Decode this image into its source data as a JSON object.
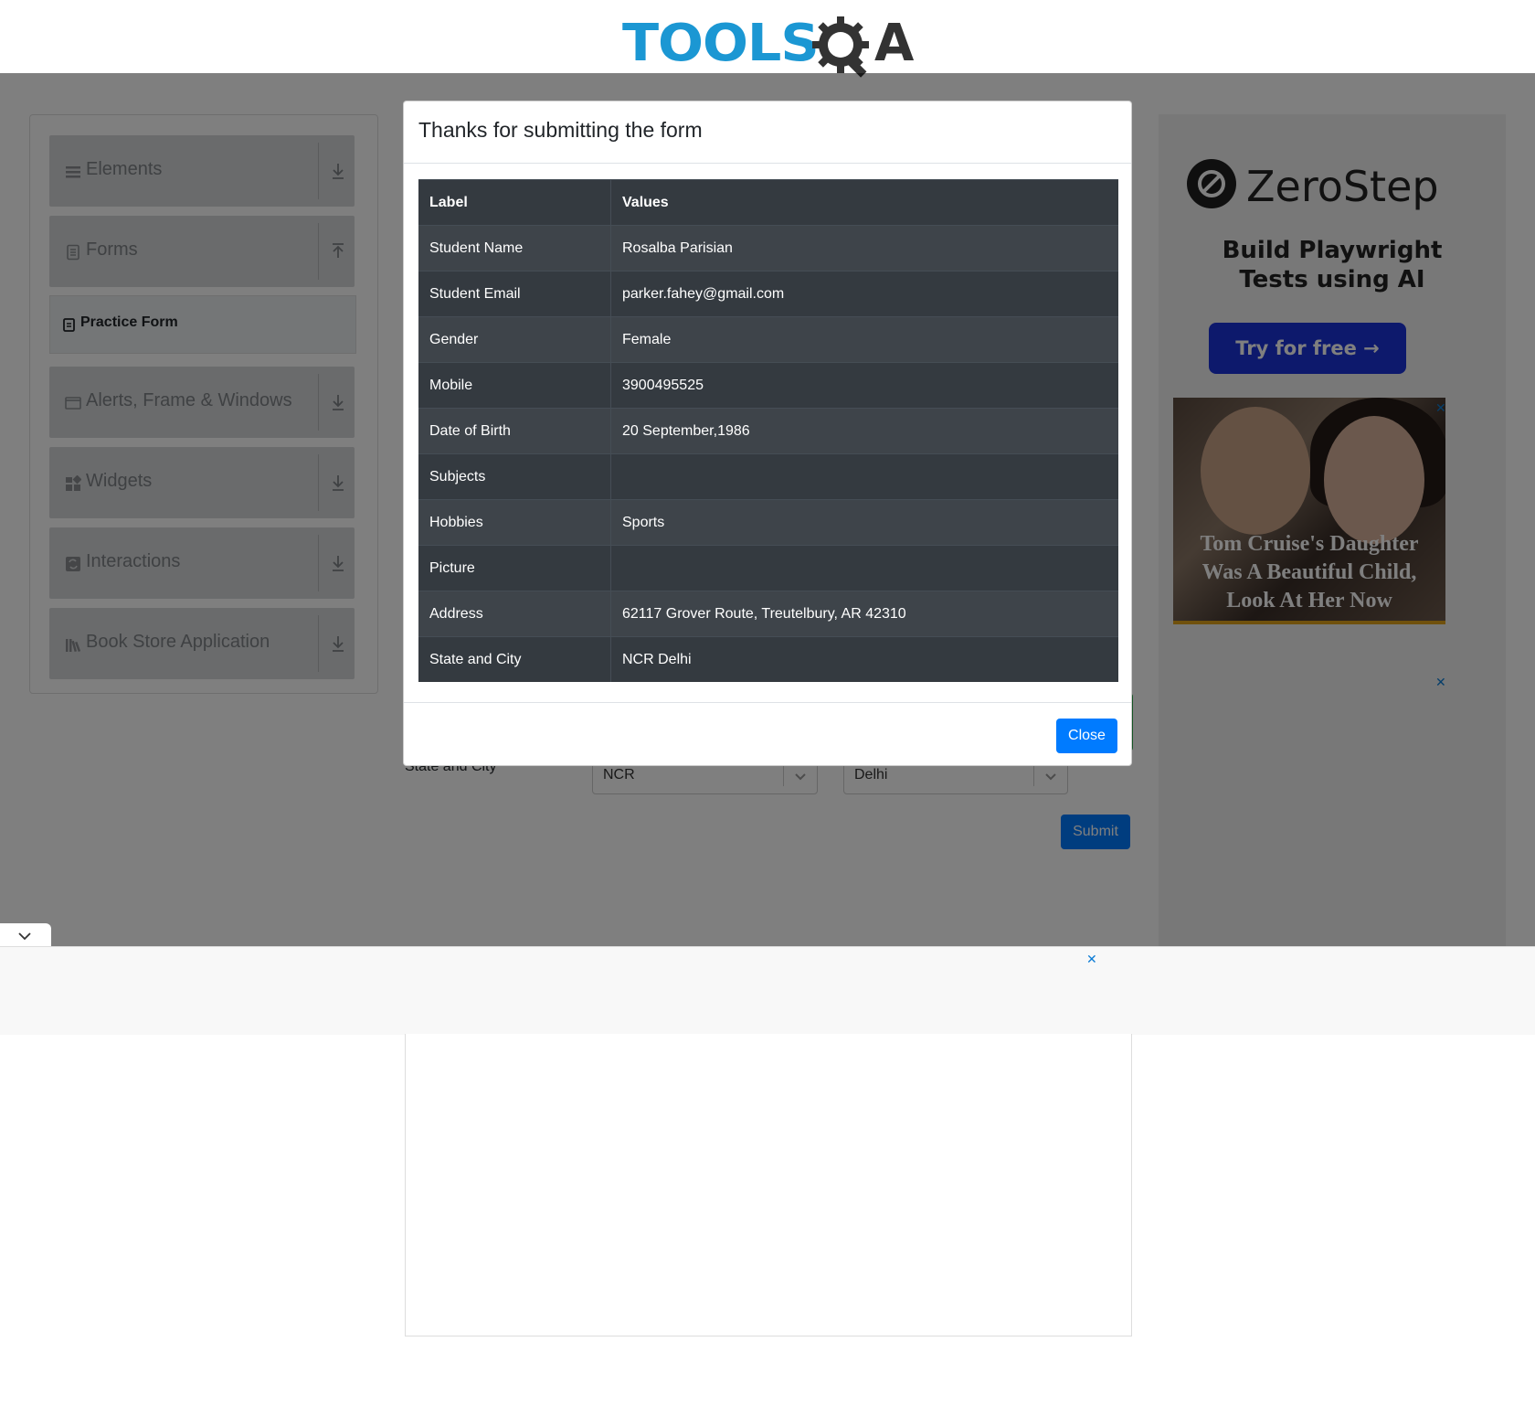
{
  "header": {
    "logo_text": "TOOLS",
    "logo_text_end": "A"
  },
  "sidebar": {
    "groups": [
      {
        "label": "Elements",
        "icon": "list-icon",
        "arrow": "download-arrow-icon"
      },
      {
        "label": "Forms",
        "icon": "document-icon",
        "arrow": "upload-arrow-icon"
      },
      {
        "label": "Alerts, Frame & Windows",
        "icon": "window-icon",
        "arrow": "download-arrow-icon"
      },
      {
        "label": "Widgets",
        "icon": "widgets-icon",
        "arrow": "download-arrow-icon"
      },
      {
        "label": "Interactions",
        "icon": "interactions-icon",
        "arrow": "download-arrow-icon"
      },
      {
        "label": "Book Store Application",
        "icon": "books-icon",
        "arrow": "download-arrow-icon"
      }
    ],
    "active_item": "Practice Form"
  },
  "form": {
    "state_city_label": "State and City",
    "state_value": "NCR",
    "city_value": "Delhi",
    "submit_label": "Submit"
  },
  "modal": {
    "title": "Thanks for submitting the form",
    "header_label": "Label",
    "header_values": "Values",
    "rows": [
      {
        "label": "Student Name",
        "value": "Rosalba Parisian"
      },
      {
        "label": "Student Email",
        "value": "parker.fahey@gmail.com"
      },
      {
        "label": "Gender",
        "value": "Female"
      },
      {
        "label": "Mobile",
        "value": "3900495525"
      },
      {
        "label": "Date of Birth",
        "value": "20 September,1986"
      },
      {
        "label": "Subjects",
        "value": ""
      },
      {
        "label": "Hobbies",
        "value": "Sports"
      },
      {
        "label": "Picture",
        "value": ""
      },
      {
        "label": "Address",
        "value": "62117 Grover Route, Treutelbury, AR 42310"
      },
      {
        "label": "State and City",
        "value": "NCR Delhi"
      }
    ],
    "close_label": "Close"
  },
  "ads": {
    "zerostep_name": "ZeroStep",
    "zerostep_tagline": "Build Playwright Tests using AI",
    "zerostep_button": "Try for free →",
    "photo_caption": "Tom Cruise's Daughter Was A Beautiful Child, Look At Her Now",
    "close_glyph": "✕"
  },
  "colors": {
    "primary": "#007bff",
    "brand_blue": "#1b97d3",
    "table_dark": "#343a40"
  }
}
